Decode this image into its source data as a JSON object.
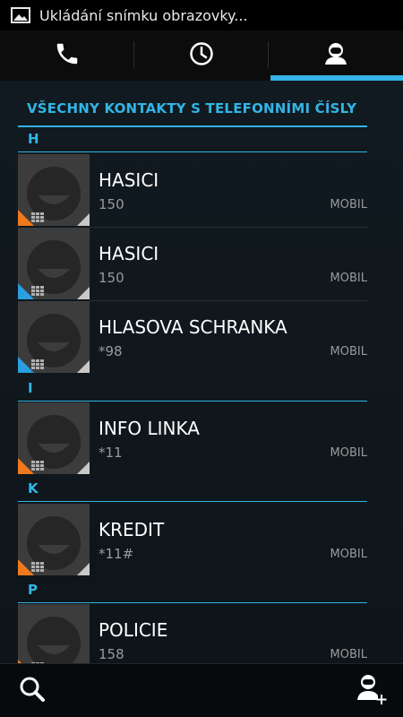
{
  "status_bar": {
    "notification_icon": "image-icon",
    "notification_text": "Ukládání snímku obrazovky..."
  },
  "tabs": [
    {
      "icon": "phone-icon",
      "active": false
    },
    {
      "icon": "clock-icon",
      "active": false
    },
    {
      "icon": "person-icon",
      "active": true
    }
  ],
  "list": {
    "section_title": "VŠECHNY KONTAKTY S TELEFONNÍMI ČÍSLY",
    "groups": [
      {
        "letter": "H",
        "contacts": [
          {
            "name": "HASICI",
            "number": "150",
            "type": "MOBIL",
            "badge": "orange"
          },
          {
            "name": "HASICI",
            "number": "150",
            "type": "MOBIL",
            "badge": "blue"
          },
          {
            "name": "HLASOVA SCHRANKA",
            "number": "*98",
            "type": "MOBIL",
            "badge": "blue"
          }
        ]
      },
      {
        "letter": "I",
        "contacts": [
          {
            "name": "INFO LINKA",
            "number": "*11",
            "type": "MOBIL",
            "badge": "orange"
          }
        ]
      },
      {
        "letter": "K",
        "contacts": [
          {
            "name": "KREDIT",
            "number": "*11#",
            "type": "MOBIL",
            "badge": "orange"
          }
        ]
      },
      {
        "letter": "P",
        "contacts": [
          {
            "name": "POLICIE",
            "number": "158",
            "type": "MOBIL",
            "badge": "orange"
          }
        ]
      }
    ]
  },
  "bottom_bar": {
    "left_icon": "search-icon",
    "right_icon": "add-contact-icon"
  },
  "colors": {
    "accent": "#33b5e5",
    "badge_orange": "#f0781e",
    "badge_blue": "#2a9ee0"
  }
}
